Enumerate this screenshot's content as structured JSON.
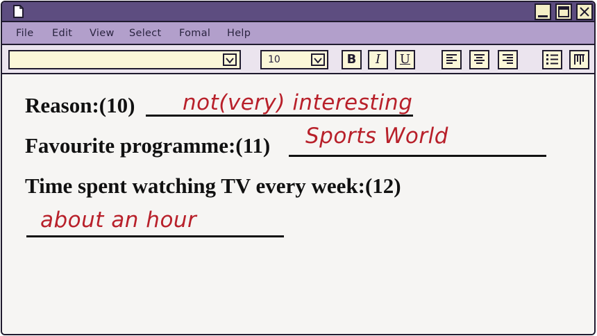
{
  "menu": {
    "items": [
      "File",
      "Edit",
      "View",
      "Select",
      "Fomal",
      "Help"
    ]
  },
  "toolbar": {
    "font_value": "",
    "size_value": "10",
    "bold_label": "B",
    "italic_label": "I",
    "underline_label": "U"
  },
  "document": {
    "lines": [
      "Reason:(10)",
      "Favourite programme:(11)",
      "Time spent watching TV every week:(12)"
    ],
    "answers": [
      "not(very) interesting",
      "Sports World",
      "about an hour"
    ]
  },
  "colors": {
    "titlebar": "#5d4d80",
    "menubar": "#b29fcb",
    "toolbar": "#ebe4ee",
    "button_face": "#fbf7d8",
    "answer_ink": "#b8202a"
  },
  "icons": {
    "window": [
      "document-icon",
      "minimize-icon",
      "maximize-icon",
      "close-icon"
    ],
    "toolbar": [
      "dropdown-arrow-icon",
      "align-left-icon",
      "align-center-icon",
      "align-right-icon",
      "bullet-list-icon",
      "columns-icon"
    ]
  }
}
